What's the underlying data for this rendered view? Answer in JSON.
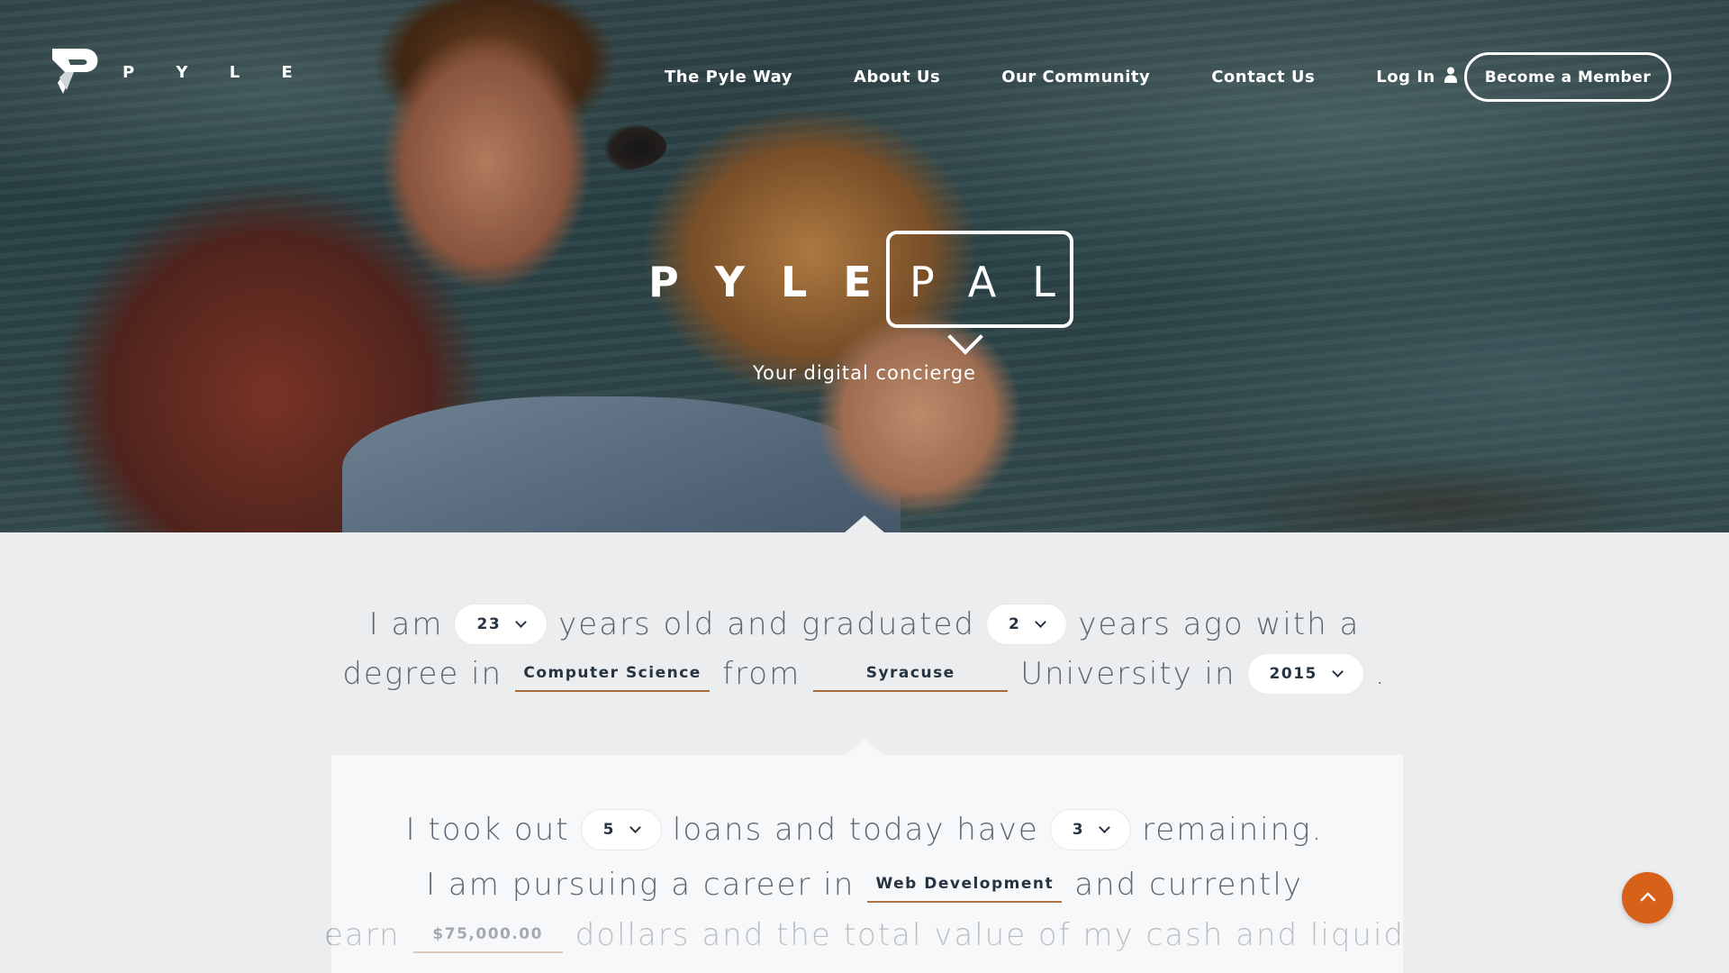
{
  "brand": {
    "logo_text": "P Y L E"
  },
  "nav": {
    "items": [
      "The Pyle Way",
      "About Us",
      "Our Community",
      "Contact Us"
    ],
    "login_label": "Log In",
    "cta_label": "Become a Member"
  },
  "hero": {
    "title_bold": "PYLE",
    "title_light": "PAL",
    "tagline": "Your digital concierge"
  },
  "form": {
    "line1": {
      "w1": "I am",
      "age": "23",
      "w2": "years old and graduated",
      "years_ago": "2",
      "w3": "years ago with a"
    },
    "line2": {
      "w1": "degree in",
      "degree": "Computer Science",
      "w2": "from",
      "university": "Syracuse",
      "w3": "University in",
      "grad_year": "2015",
      "w4": "."
    },
    "line3": {
      "w1": "I took out",
      "loans": "5",
      "w2": "loans and today have",
      "remaining": "3",
      "w3": "remaining."
    },
    "line4": {
      "w1": "I am pursuing a career in",
      "career": "Web Development",
      "w2": "and currently"
    },
    "line5": {
      "w1": "earn",
      "salary": "$75,000.00",
      "w2": "dollars and the total value of my cash and liquid"
    }
  },
  "colors": {
    "accent": "#d8611a",
    "underline": "#a66b38",
    "text": "#5b6670",
    "value_text": "#263340"
  },
  "icons": {
    "user": "user-icon",
    "chevron": "chevron-down-icon",
    "back_to_top": "chevron-up-icon"
  }
}
